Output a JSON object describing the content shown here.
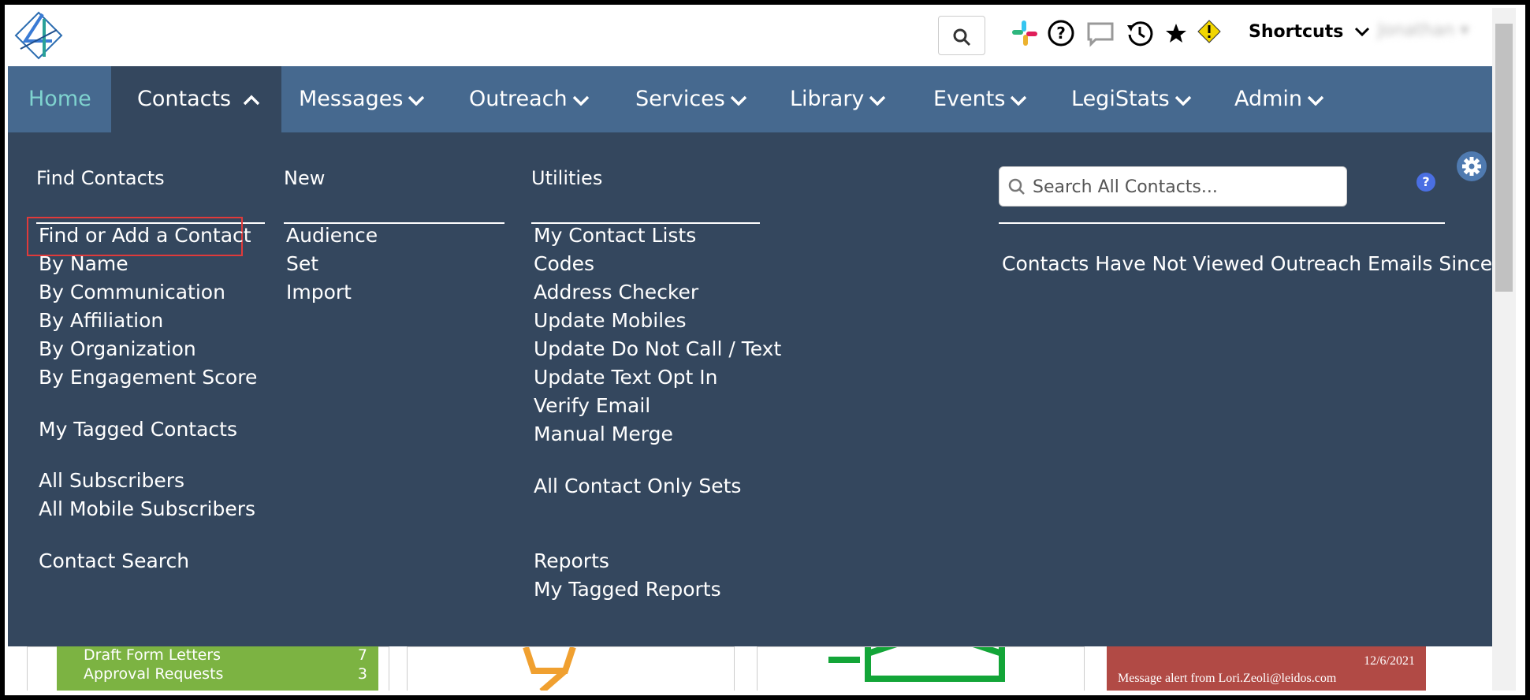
{
  "topbar": {
    "shortcuts_label": "Shortcuts",
    "user_name": "Jonathan",
    "icons": [
      "search-icon",
      "slack-icon",
      "help-icon",
      "chat-icon",
      "history-icon",
      "star-icon",
      "alert-icon"
    ]
  },
  "nav": {
    "items": [
      {
        "label": "Home"
      },
      {
        "label": "Contacts"
      },
      {
        "label": "Messages"
      },
      {
        "label": "Outreach"
      },
      {
        "label": "Services"
      },
      {
        "label": "Library"
      },
      {
        "label": "Events"
      },
      {
        "label": "LegiStats"
      },
      {
        "label": "Admin"
      }
    ]
  },
  "menu": {
    "find_contacts": {
      "heading": "Find Contacts",
      "links": [
        "Find or Add a Contact",
        "By Name",
        "By Communication",
        "By Affiliation",
        "By Organization",
        "By Engagement Score",
        "My Tagged Contacts",
        "All Subscribers",
        "All Mobile Subscribers",
        "Contact Search"
      ]
    },
    "new": {
      "heading": "New",
      "links": [
        "Audience",
        "Set",
        "Import"
      ]
    },
    "utilities": {
      "heading": "Utilities",
      "links": [
        "My Contact Lists",
        "Codes",
        "Address Checker",
        "Update Mobiles",
        "Update Do Not Call / Text",
        "Update Text Opt In",
        "Verify Email",
        "Manual Merge",
        "All Contact Only Sets",
        "Reports",
        "My Tagged Reports"
      ]
    },
    "search": {
      "placeholder": "Search All Contacts...",
      "help": "?"
    },
    "not_viewed_text": "Contacts Have Not Viewed Outreach Emails Since"
  },
  "bottom": {
    "green_rows": [
      {
        "label": "Draft Form Letters",
        "count": "7"
      },
      {
        "label": "Approval Requests",
        "count": "3"
      }
    ],
    "alert_date": "12/6/2021",
    "alert_text": "Message alert from Lori.Zeoli@leidos.com"
  },
  "colors": {
    "nav_bg": "#46698f",
    "menu_bg": "#34475e",
    "accent": "#3fb3ad",
    "highlight": "#e03a3a"
  }
}
